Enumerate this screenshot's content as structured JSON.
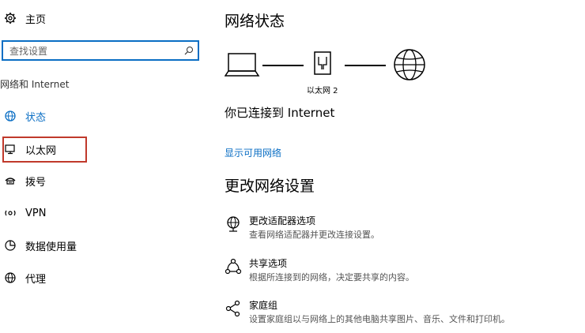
{
  "sidebar": {
    "home_label": "主页",
    "search_placeholder": "查找设置",
    "section_label": "网络和 Internet",
    "items": [
      {
        "label": "状态"
      },
      {
        "label": "以太网"
      },
      {
        "label": "拨号"
      },
      {
        "label": "VPN"
      },
      {
        "label": "数据使用量"
      },
      {
        "label": "代理"
      }
    ]
  },
  "main": {
    "title": "网络状态",
    "diagram": {
      "adapter_label": "以太网 2"
    },
    "connection_status": "你已连接到 Internet",
    "show_networks_link": "显示可用网络",
    "change_title": "更改网络设置",
    "settings": [
      {
        "title": "更改适配器选项",
        "desc": "查看网络适配器并更改连接设置。"
      },
      {
        "title": "共享选项",
        "desc": "根据所连接到的网络，决定要共享的内容。"
      },
      {
        "title": "家庭组",
        "desc": "设置家庭组以与网络上的其他电脑共享图片、音乐、文件和打印机。"
      }
    ]
  },
  "colors": {
    "accent": "#0a6ec4",
    "highlight": "#c0392b"
  }
}
